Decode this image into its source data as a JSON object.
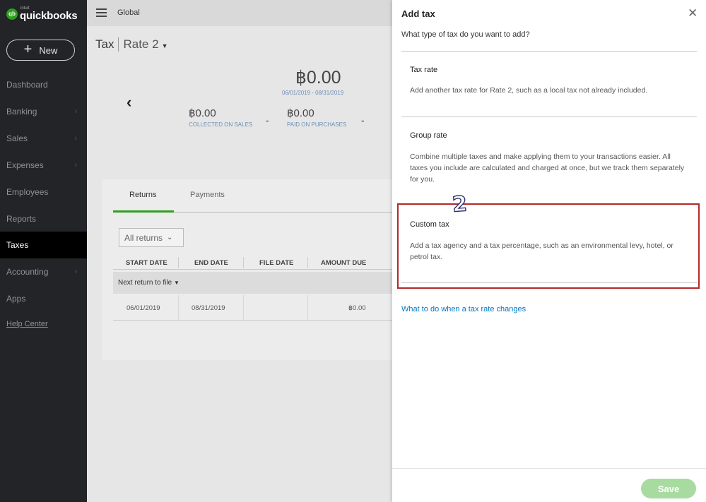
{
  "sidebar": {
    "logo_prefix": "intuit",
    "logo_name": "quickbooks",
    "logo_badge": "qb",
    "new_label": "New",
    "items": [
      {
        "label": "Dashboard",
        "chevron": false
      },
      {
        "label": "Banking",
        "chevron": true
      },
      {
        "label": "Sales",
        "chevron": true
      },
      {
        "label": "Expenses",
        "chevron": true
      },
      {
        "label": "Employees",
        "chevron": false
      },
      {
        "label": "Reports",
        "chevron": false
      },
      {
        "label": "Taxes",
        "chevron": false,
        "active": true
      },
      {
        "label": "Accounting",
        "chevron": true
      },
      {
        "label": "Apps",
        "chevron": false
      }
    ],
    "help": "Help Center"
  },
  "topbar": {
    "company": "Global"
  },
  "main": {
    "title": "Tax",
    "rate": "Rate 2",
    "summary": {
      "total": "฿0.00",
      "period": "06/01/2019 - 08/31/2019",
      "collected_amount": "฿0.00",
      "collected_caption": "COLLECTED ON SALES",
      "paid_amount": "฿0.00",
      "paid_caption": "PAID ON PURCHASES",
      "dash": "-"
    },
    "tabs": [
      "Returns",
      "Payments"
    ],
    "filter": "All returns",
    "table": {
      "headers": [
        "START DATE",
        "END DATE",
        "FILE DATE",
        "AMOUNT DUE"
      ],
      "group_label": "Next return to file",
      "rows": [
        {
          "start": "06/01/2019",
          "end": "08/31/2019",
          "file": "",
          "amount": "฿0.00"
        }
      ]
    }
  },
  "drawer": {
    "title": "Add tax",
    "question": "What type of tax do you want to add?",
    "options": [
      {
        "title": "Tax rate",
        "desc": "Add another tax rate for Rate 2, such as a local tax not already included."
      },
      {
        "title": "Group rate",
        "desc": "Combine multiple taxes and make applying them to your transactions easier. All taxes you include are calculated and charged at once, but we track them separately for you."
      },
      {
        "title": "Custom tax",
        "desc": "Add a tax agency and a tax percentage, such as an environmental levy, hotel, or petrol tax."
      }
    ],
    "annotation_step": "2",
    "help_link": "What to do when a tax rate changes",
    "save": "Save",
    "colors": {
      "highlight": "#b22a2a",
      "link": "#0077c5",
      "save_disabled": "#a8dba0",
      "brand_green": "#2ca01c"
    }
  }
}
